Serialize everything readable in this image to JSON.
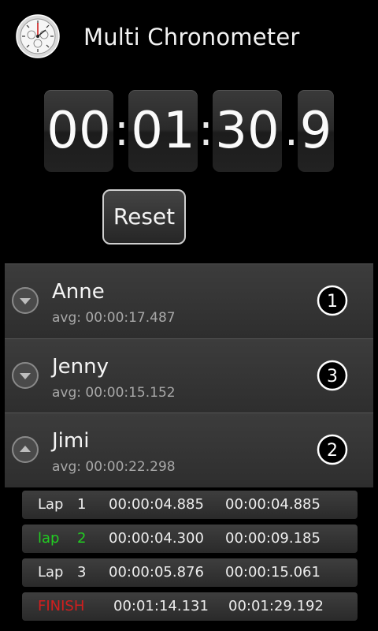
{
  "app": {
    "title": "Multi Chronometer",
    "icon": "stopwatch-icon"
  },
  "clock": {
    "hours": "00",
    "minutes": "01",
    "seconds": "30",
    "tenths": "9",
    "sep_colon": ":",
    "sep_dot": "."
  },
  "controls": {
    "reset_label": "Reset"
  },
  "racers": [
    {
      "name": "Anne",
      "avg": "avg: 00:00:17.487",
      "rank": "1",
      "expander": "expand-icon"
    },
    {
      "name": "Jenny",
      "avg": "avg: 00:00:15.152",
      "rank": "3",
      "expander": "expand-icon"
    },
    {
      "name": "Jimi",
      "avg": "avg: 00:00:22.298",
      "rank": "2",
      "expander": "collapse-icon"
    }
  ],
  "laps": [
    {
      "label": "Lap",
      "num": "1",
      "split": "00:00:04.885",
      "total": "00:00:04.885",
      "color": "#ededed"
    },
    {
      "label": "lap",
      "num": "2",
      "split": "00:00:04.300",
      "total": "00:00:09.185",
      "color": "#22cc22"
    },
    {
      "label": "Lap",
      "num": "3",
      "split": "00:00:05.876",
      "total": "00:00:15.061",
      "color": "#ededed"
    },
    {
      "label": "FINISH",
      "num": "",
      "split": "00:01:14.131",
      "total": "00:01:29.192",
      "color": "#d21e1e"
    }
  ]
}
